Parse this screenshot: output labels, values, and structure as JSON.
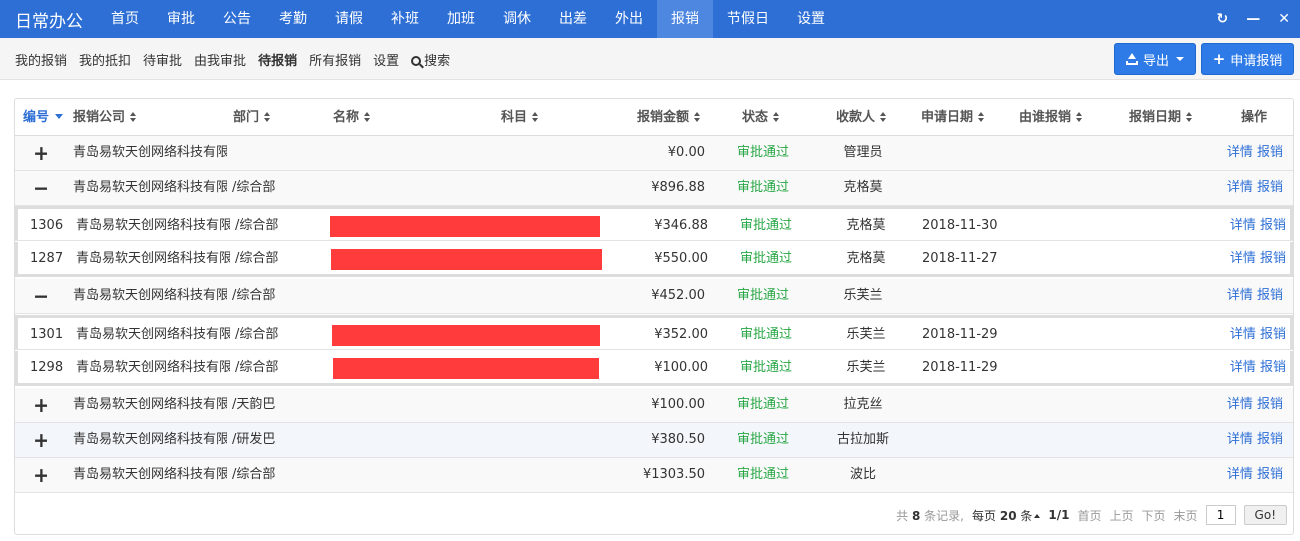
{
  "brand": "日常办公",
  "nav": [
    "首页",
    "审批",
    "公告",
    "考勤",
    "请假",
    "补班",
    "加班",
    "调休",
    "出差",
    "外出",
    "报销",
    "节假日",
    "设置"
  ],
  "nav_active_index": 10,
  "window_tools": {
    "refresh": "↻",
    "minimize": "—",
    "close": "✕"
  },
  "subnav": [
    "我的报销",
    "我的抵扣",
    "待审批",
    "由我审批",
    "待报销",
    "所有报销",
    "设置"
  ],
  "subnav_active_index": 4,
  "search_label": "搜索",
  "buttons": {
    "export": "导出",
    "apply": "申请报销"
  },
  "table": {
    "headers": [
      "编号",
      "报销公司",
      "部门",
      "名称",
      "科目",
      "报销金额",
      "状态",
      "收款人",
      "申请日期",
      "由谁报销",
      "报销日期",
      "操作"
    ],
    "rows": [
      {
        "type": "group",
        "toggle": "+",
        "company": "青岛易软天创网络科技有限",
        "dept": "",
        "amount": "¥0.00",
        "status": "审批通过",
        "payee": "管理员"
      },
      {
        "type": "group",
        "toggle": "−",
        "company": "青岛易软天创网络科技有限",
        "dept": "/综合部",
        "amount": "¥896.88",
        "status": "审批通过",
        "payee": "克格莫"
      },
      {
        "type": "detail",
        "id": "1306",
        "company": "青岛易软天创网络科技有限",
        "dept": "/综合部",
        "amount": "¥346.88",
        "status": "审批通过",
        "payee": "克格莫",
        "date": "2018-11-30"
      },
      {
        "type": "detail",
        "id": "1287",
        "company": "青岛易软天创网络科技有限",
        "dept": "/综合部",
        "amount": "¥550.00",
        "status": "审批通过",
        "payee": "克格莫",
        "date": "2018-11-27"
      },
      {
        "type": "group",
        "toggle": "−",
        "company": "青岛易软天创网络科技有限",
        "dept": "/综合部",
        "amount": "¥452.00",
        "status": "审批通过",
        "payee": "乐芙兰"
      },
      {
        "type": "detail",
        "id": "1301",
        "company": "青岛易软天创网络科技有限",
        "dept": "/综合部",
        "amount": "¥352.00",
        "status": "审批通过",
        "payee": "乐芙兰",
        "date": "2018-11-29"
      },
      {
        "type": "detail",
        "id": "1298",
        "company": "青岛易软天创网络科技有限",
        "dept": "/综合部",
        "amount": "¥100.00",
        "status": "审批通过",
        "payee": "乐芙兰",
        "date": "2018-11-29"
      },
      {
        "type": "group",
        "toggle": "+",
        "company": "青岛易软天创网络科技有限",
        "dept": "/天韵巴",
        "amount": "¥100.00",
        "status": "审批通过",
        "payee": "拉克丝"
      },
      {
        "type": "group",
        "toggle": "+",
        "company": "青岛易软天创网络科技有限",
        "dept": "/研发巴",
        "amount": "¥380.50",
        "status": "审批通过",
        "payee": "古拉加斯"
      },
      {
        "type": "group",
        "toggle": "+",
        "company": "青岛易软天创网络科技有限",
        "dept": "/综合部",
        "amount": "¥1303.50",
        "status": "审批通过",
        "payee": "波比"
      }
    ],
    "ops": {
      "detail": "详情",
      "reimburse": "报销"
    }
  },
  "pager": {
    "total_prefix": "共",
    "total": "8",
    "total_suffix": "条记录,",
    "per_prefix": "每页",
    "per": "20",
    "per_suffix": "条",
    "page": "1/1",
    "first": "首页",
    "prev": "上页",
    "next": "下页",
    "last": "末页",
    "input_value": "1",
    "go": "Go!"
  },
  "colors": {
    "nav_bg": "#2e6fd6",
    "nav_active": "#4d87e0",
    "status_ok": "#28a745",
    "link": "#2e6fd6",
    "redaction": "#ff3b3b"
  }
}
